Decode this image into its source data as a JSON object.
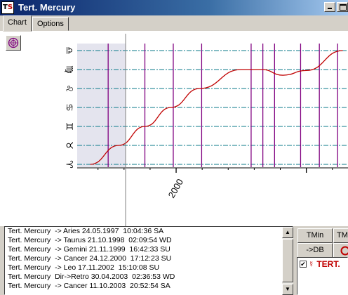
{
  "window": {
    "title": "Tert. Mercury",
    "icon_text": "TS"
  },
  "tabs": [
    {
      "label": "Chart",
      "active": true
    },
    {
      "label": "Options",
      "active": false
    }
  ],
  "chart_data": {
    "type": "line",
    "y_tick_labels": [
      "♈",
      "♉",
      "♊",
      "♋",
      "♌",
      "♍",
      "♎"
    ],
    "x_tick_labels": [
      "2000"
    ],
    "series": [
      {
        "values": [
          [
            1996.7,
            0.0
          ],
          [
            1997.8,
            1.0
          ],
          [
            1998.8,
            2.0
          ],
          [
            1999.8,
            3.0
          ],
          [
            2000.9,
            4.0
          ],
          [
            2002.5,
            5.0
          ],
          [
            2003.3,
            5.0
          ],
          [
            2004.1,
            4.7
          ],
          [
            2005.0,
            4.95
          ],
          [
            2006.4,
            6.0
          ]
        ]
      }
    ],
    "colors": {
      "curve": "#c00000",
      "ingress_line": "#800080",
      "grid": "#0a7a8a",
      "shade": "#e4e4ee"
    }
  },
  "log": {
    "lines": [
      "Tert. Mercury  -> Aries 24.05.1997  10:04:36 SA",
      "Tert. Mercury  -> Taurus 21.10.1998  02:09:54 WD",
      "Tert. Mercury  -> Gemini 21.11.1999  16:42:33 SU",
      "Tert. Mercury  -> Cancer 24.12.2000  17:12:23 SU",
      "Tert. Mercury  -> Leo 17.11.2002  15:10:08 SU",
      "Tert. Mercury  Dir->Retro 30.04.2003  02:36:53 WD",
      "Tert. Mercury  -> Cancer 11.10.2003  20:52:54 SA"
    ]
  },
  "buttons": {
    "tmin": "TMin",
    "tmax": "TMax",
    "todb": "->DB"
  },
  "planets": [
    {
      "label": "☿ TERT.",
      "checked": true
    }
  ]
}
